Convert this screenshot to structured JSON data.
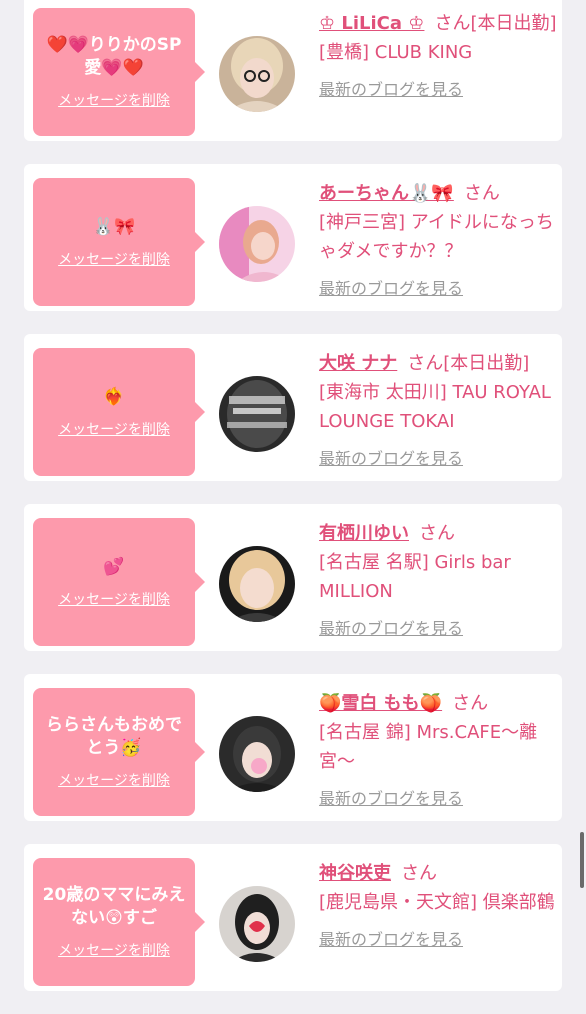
{
  "blog_link_label": "最新のブログを見る",
  "delete_label": "メッセージを削除",
  "san_label": "さん",
  "cards": [
    {
      "message": "❤️💗りりかのSP愛💗❤️",
      "name": "♔ LiLiCa ♔",
      "status": "[本日出勤]",
      "shop": "[豊橋] CLUB KING"
    },
    {
      "message": "🐰🎀",
      "name": "あーちゃん🐰🎀",
      "status": "",
      "shop": "[神戸三宮] アイドルになっちゃダメですか？？"
    },
    {
      "message": "❤️‍🔥",
      "name": "大咲 ナナ",
      "status": "[本日出勤]",
      "shop": "[東海市 太田川] TAU ROYAL LOUNGE TOKAI"
    },
    {
      "message": "💕",
      "name": "有栖川ゆい",
      "status": "",
      "shop": "[名古屋 名駅] Girls bar MILLION"
    },
    {
      "message": "ららさんもおめでとう🥳",
      "name": "🍑雪白 もも🍑",
      "status": "",
      "shop": "[名古屋 錦] Mrs.CAFE〜離宮〜"
    },
    {
      "message": "20歳のママにみえない😲すご",
      "name": "神谷咲吏",
      "status": "",
      "shop": "[鹿児島県・天文館] 倶楽部鶴"
    }
  ]
}
